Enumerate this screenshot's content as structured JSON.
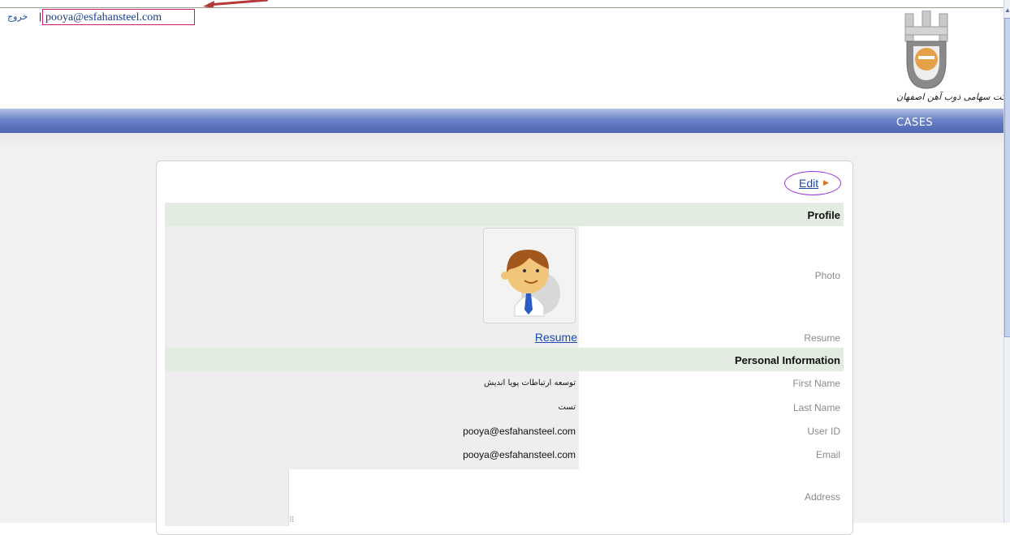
{
  "header": {
    "logout_label": "خروج",
    "separator": "|",
    "user_email": "pooya@esfahansteel.com",
    "logo_caption": "شرکت سهامی ذوب آهن اصفهان"
  },
  "nav": {
    "cases_label": "CASES"
  },
  "card": {
    "edit_label": "Edit",
    "edit_arrow": "▶"
  },
  "profile": {
    "section_title": "Profile",
    "photo_label": "Photo",
    "resume_label": "Resume",
    "resume_link": "Resume"
  },
  "personal": {
    "section_title": "Personal Information",
    "fields": [
      {
        "label": "First Name",
        "value": "توسعه ارتباطات پویا اندیش"
      },
      {
        "label": "Last Name",
        "value": "تست"
      },
      {
        "label": "User ID",
        "value": "pooya@esfahansteel.com"
      },
      {
        "label": "Email",
        "value": "pooya@esfahansteel.com"
      }
    ],
    "address_label": "Address"
  },
  "colors": {
    "nav_blue": "#4c64b0",
    "section_green": "#e3ece0",
    "link_blue": "#1a4bb0",
    "annotation_pink": "#cc1c6e",
    "annotation_purple": "#9a33d6"
  }
}
